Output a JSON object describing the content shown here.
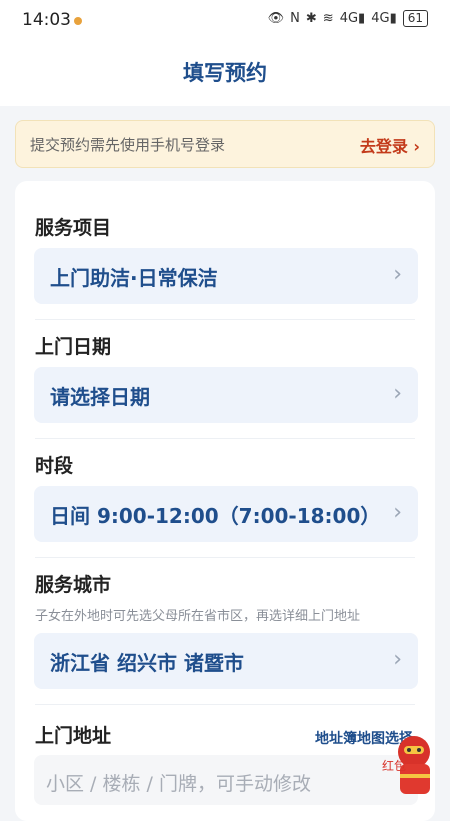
{
  "status_bar": {
    "time": "14:03",
    "signal_1": "4G",
    "signal_2": "4G",
    "battery": "61"
  },
  "header": {
    "title": "填写预约"
  },
  "notice": {
    "text": "提交预约需先使用手机号登录",
    "action": "去登录 ›"
  },
  "form": {
    "service": {
      "label": "服务项目",
      "value": "上门助洁·日常保洁"
    },
    "date": {
      "label": "上门日期",
      "value": "请选择日期"
    },
    "period": {
      "label": "时段",
      "value": "日间 9:00-12:00（7:00-18:00）"
    },
    "city": {
      "label": "服务城市",
      "hint": "子女在外地时可先选父母所在省市区，再选详细上门地址",
      "value": "浙江省 绍兴市 诸暨市"
    },
    "address": {
      "label": "上门地址",
      "link": "地址簿地图选择",
      "placeholder": "小区 / 楼栋 / 门牌，可手动修改"
    }
  },
  "mascot": {
    "text": "红包"
  },
  "icons": {
    "chevron": "chevron-right-icon"
  },
  "colors": {
    "accent": "#1f4e8c",
    "field_bg": "#eef3fb",
    "notice_bg": "#fdf3dd",
    "notice_action": "#c33a1a"
  }
}
